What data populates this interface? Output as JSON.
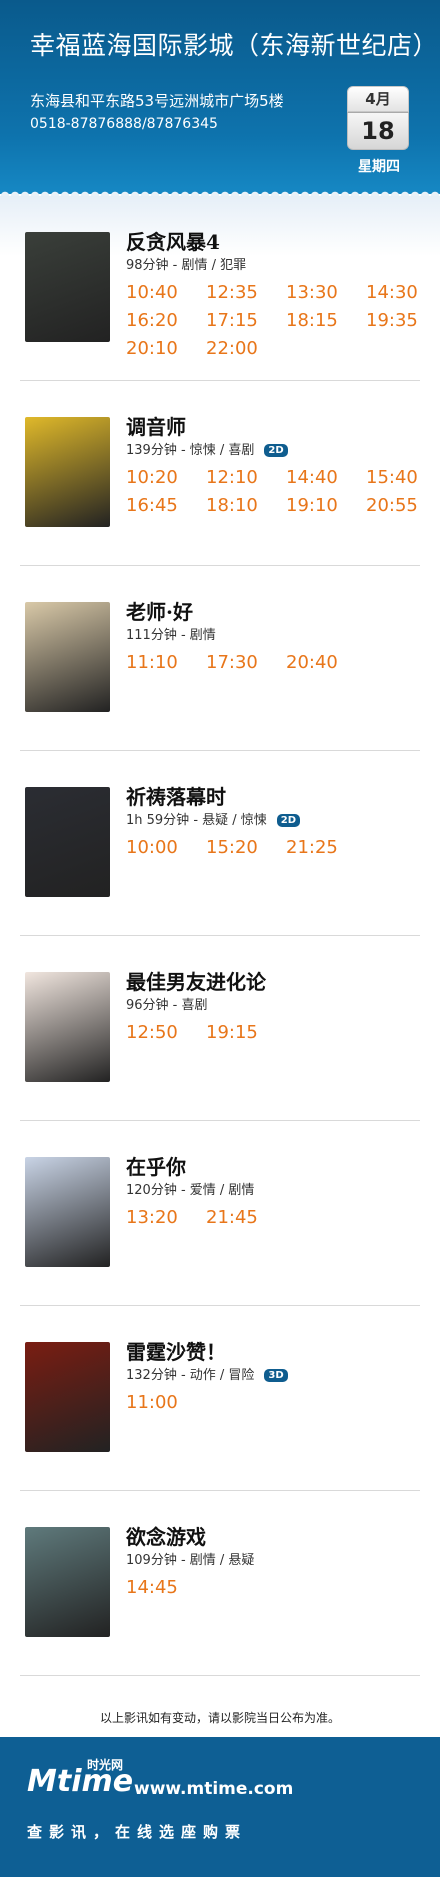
{
  "header": {
    "cinema_name": "幸福蓝海国际影城（东海新世纪店）",
    "address": "东海县和平东路53号远洲城市广场5楼",
    "phone": "0518-87876888/87876345",
    "date_month": "4月",
    "date_day": "18",
    "weekday": "星期四"
  },
  "movies": [
    {
      "title": "反贪风暴4",
      "meta": "98分钟 - 剧情 / 犯罪",
      "format": "",
      "poster_color": "#3a3f3a",
      "times": [
        "10:40",
        "12:35",
        "13:30",
        "14:30",
        "16:20",
        "17:15",
        "18:15",
        "19:35",
        "20:10",
        "22:00"
      ]
    },
    {
      "title": "调音师",
      "meta": "139分钟 - 惊悚 / 喜剧",
      "format": "2D",
      "poster_color": "#e0b92a",
      "times": [
        "10:20",
        "12:10",
        "14:40",
        "15:40",
        "16:45",
        "18:10",
        "19:10",
        "20:55"
      ]
    },
    {
      "title": "老师·好",
      "meta": "111分钟 - 剧情",
      "format": "",
      "poster_color": "#d9c9a8",
      "times": [
        "11:10",
        "17:30",
        "20:40"
      ]
    },
    {
      "title": "祈祷落幕时",
      "meta": "1h 59分钟 - 悬疑 / 惊悚",
      "format": "2D",
      "poster_color": "#2b2d33",
      "times": [
        "10:00",
        "15:20",
        "21:25"
      ]
    },
    {
      "title": "最佳男友进化论",
      "meta": "96分钟 - 喜剧",
      "format": "",
      "poster_color": "#f1e6df",
      "times": [
        "12:50",
        "19:15"
      ]
    },
    {
      "title": "在乎你",
      "meta": "120分钟 - 爱情 / 剧情",
      "format": "",
      "poster_color": "#c9d4e6",
      "times": [
        "13:20",
        "21:45"
      ]
    },
    {
      "title": "雷霆沙赞！",
      "meta": "132分钟 - 动作 / 冒险",
      "format": "3D",
      "poster_color": "#7a1d12",
      "times": [
        "11:00"
      ]
    },
    {
      "title": "欲念游戏",
      "meta": "109分钟 - 剧情 / 悬疑",
      "format": "",
      "poster_color": "#5f7a7c",
      "times": [
        "14:45"
      ]
    }
  ],
  "notice": "以上影讯如有变动，请以影院当日公布为准。",
  "footer": {
    "logo_m": "M",
    "logo_time": "time",
    "logo_cn": "时光网",
    "site_url": "www.mtime.com",
    "slogan": "查影讯，在线选座购票"
  }
}
